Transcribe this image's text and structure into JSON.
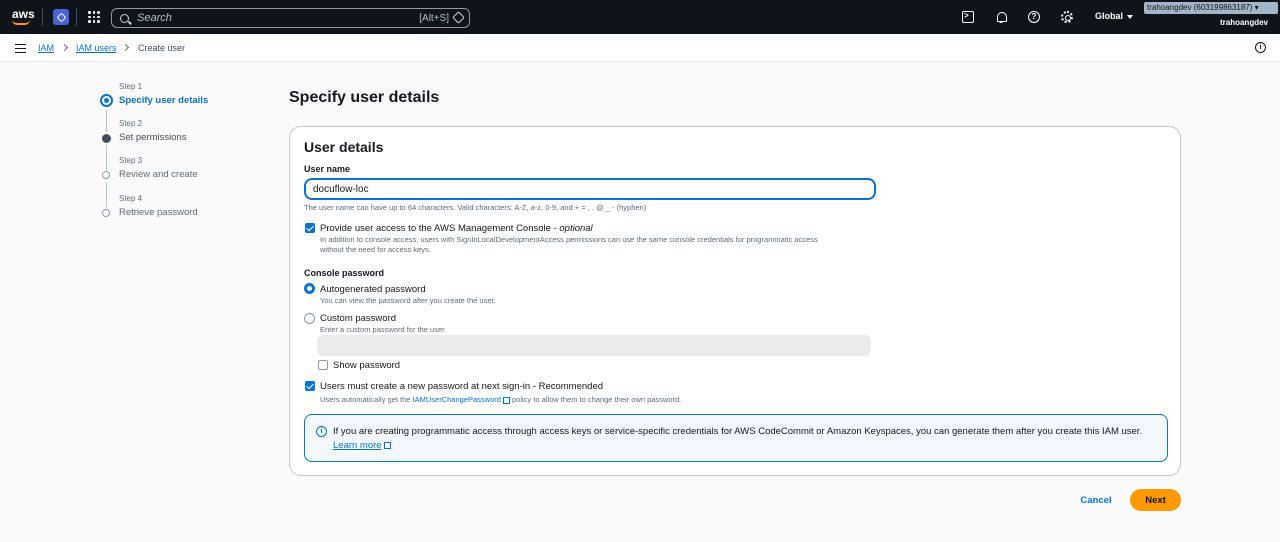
{
  "topnav": {
    "logo_text": "aws",
    "search_placeholder": "Search",
    "search_shortcut": "[Alt+S]",
    "region_label": "Global",
    "account_badge": "trahoangdev (603199863187) ▾",
    "account_user": "trahoangdev",
    "accent_color": "#ff9900"
  },
  "breadcrumb": {
    "items": [
      {
        "label": "IAM",
        "link": true
      },
      {
        "label": "IAM users",
        "link": true
      },
      {
        "label": "Create user",
        "link": false
      }
    ]
  },
  "steps": [
    {
      "num": "Step 1",
      "label": "Specify user details",
      "state": "active"
    },
    {
      "num": "Step 2",
      "label": "Set permissions",
      "state": "done"
    },
    {
      "num": "Step 3",
      "label": "Review and create",
      "state": "pending"
    },
    {
      "num": "Step 4",
      "label": "Retrieve password",
      "state": "pending"
    }
  ],
  "page_title": "Specify user details",
  "panel": {
    "title": "User details",
    "username_label": "User name",
    "username_value": "docuflow-loc",
    "username_hint": "The user name can have up to 64 characters. Valid characters: A-Z, a-z, 0-9, and + = , . @ _ - (hyphen)",
    "console_access_label": "Provide user access to the AWS Management Console - ",
    "console_access_optional": "optional",
    "console_access_hint_1": "In addition to console access, users with SignInLocalDevelopmentAccess permissions can use the same console credentials for programmatic access",
    "console_access_hint_2": "without the need for access keys.",
    "console_password_label": "Console password",
    "auto_password_label": "Autogenerated password",
    "auto_password_hint": "You can view the password after you create the user.",
    "custom_password_label": "Custom password",
    "custom_password_hint": "Enter a custom password for the user.",
    "show_password_label": "Show password",
    "reset_label": "Users must create a new password at next sign-in - Recommended",
    "reset_hint_before": "Users automatically get the ",
    "reset_hint_link": "IAMUserChangePassword",
    "reset_hint_after": " policy to allow them to change their own password.",
    "info_text": "If you are creating programmatic access through access keys or service-specific credentials for AWS CodeCommit or Amazon Keyspaces, you can generate them after you create this IAM user.",
    "learn_more": "Learn more"
  },
  "actions": {
    "cancel": "Cancel",
    "next": "Next"
  }
}
